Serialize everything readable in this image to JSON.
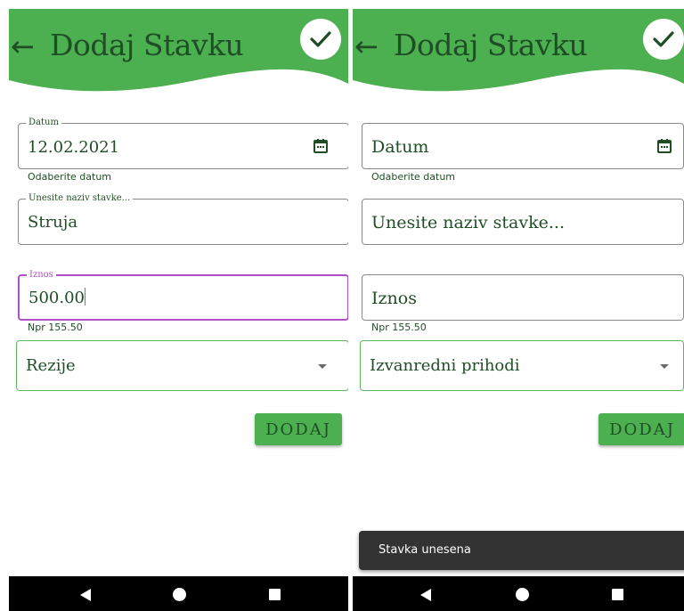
{
  "colors": {
    "header_green": "#4caf50",
    "text_dark_green": "#1f4e26",
    "focus_purple": "#b14fc5",
    "snackbar_bg": "#333333"
  },
  "screens": [
    {
      "header": {
        "back_icon": "arrow-left-icon",
        "title": "Dodaj Stavku",
        "confirm_icon": "check-icon"
      },
      "date_field": {
        "label": "Datum",
        "value": "12.02.2021",
        "helper": "Odaberite datum",
        "icon": "calendar-icon"
      },
      "name_field": {
        "label": "Unesite naziv stavke...",
        "value": "Struja"
      },
      "amount_field": {
        "label": "Iznos",
        "value": "500.00",
        "helper": "Npr 155.50",
        "focused": true
      },
      "category_select": {
        "selected": "Rezije",
        "icon": "dropdown-caret-icon"
      },
      "submit_button": "DODAJ"
    },
    {
      "header": {
        "back_icon": "arrow-left-icon",
        "title": "Dodaj Stavku",
        "confirm_icon": "check-icon"
      },
      "date_field": {
        "placeholder": "Datum",
        "helper": "Odaberite datum",
        "icon": "calendar-icon"
      },
      "name_field": {
        "placeholder": "Unesite naziv stavke..."
      },
      "amount_field": {
        "placeholder": "Iznos",
        "helper": "Npr 155.50"
      },
      "category_select": {
        "selected": "Izvanredni prihodi",
        "icon": "dropdown-caret-icon"
      },
      "submit_button": "DODAJ",
      "snackbar": "Stavka unesena"
    }
  ],
  "nav_bar": {
    "back_icon": "nav-back-icon",
    "home_icon": "nav-home-icon",
    "recents_icon": "nav-recents-icon"
  }
}
